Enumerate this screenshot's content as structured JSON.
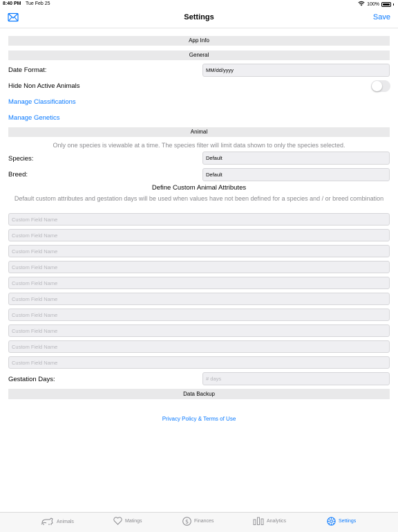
{
  "status": {
    "time": "8:40 PM",
    "date": "Tue Feb 25",
    "battery": "100%"
  },
  "nav": {
    "title": "Settings",
    "save_label": "Save"
  },
  "sections": {
    "app_info": "App Info",
    "general": "General",
    "animal": "Animal",
    "data_backup": "Data Backup"
  },
  "general": {
    "date_format_label": "Date Format:",
    "date_format_value": "MM/dd/yyyy",
    "hide_inactive_label": "Hide Non Active Animals",
    "hide_inactive_on": false,
    "manage_classifications": "Manage Classifications",
    "manage_genetics": "Manage Genetics"
  },
  "animal": {
    "species_note": "Only one species is viewable at a time. The species filter will limit data shown to only the species selected.",
    "species_label": "Species:",
    "species_value": "Default",
    "breed_label": "Breed:",
    "breed_value": "Default",
    "custom_title": "Define Custom Animal Attributes",
    "custom_note": "Default custom attributes and gestation days will be used when values have not been defined for a species and / or breed combination",
    "custom_fields": [
      "Custom Field Name",
      "Custom Field Name",
      "Custom Field Name",
      "Custom Field Name",
      "Custom Field Name",
      "Custom Field Name",
      "Custom Field Name",
      "Custom Field Name",
      "Custom Field Name",
      "Custom Field Name"
    ],
    "gestation_label": "Gestation Days:",
    "gestation_placeholder": "# days"
  },
  "privacy_link": "Privacy Policy & Terms of Use",
  "tabs": [
    {
      "label": "Animals",
      "icon": "animals-icon",
      "active": false
    },
    {
      "label": "Matings",
      "icon": "heart-icon",
      "active": false
    },
    {
      "label": "Finances",
      "icon": "dollar-icon",
      "active": false
    },
    {
      "label": "Analytics",
      "icon": "bar-chart-icon",
      "active": false
    },
    {
      "label": "Settings",
      "icon": "gear-icon",
      "active": true
    }
  ],
  "colors": {
    "accent": "#0a7aff",
    "section_bg": "#e9e9ea",
    "field_bg": "#efeff2"
  }
}
